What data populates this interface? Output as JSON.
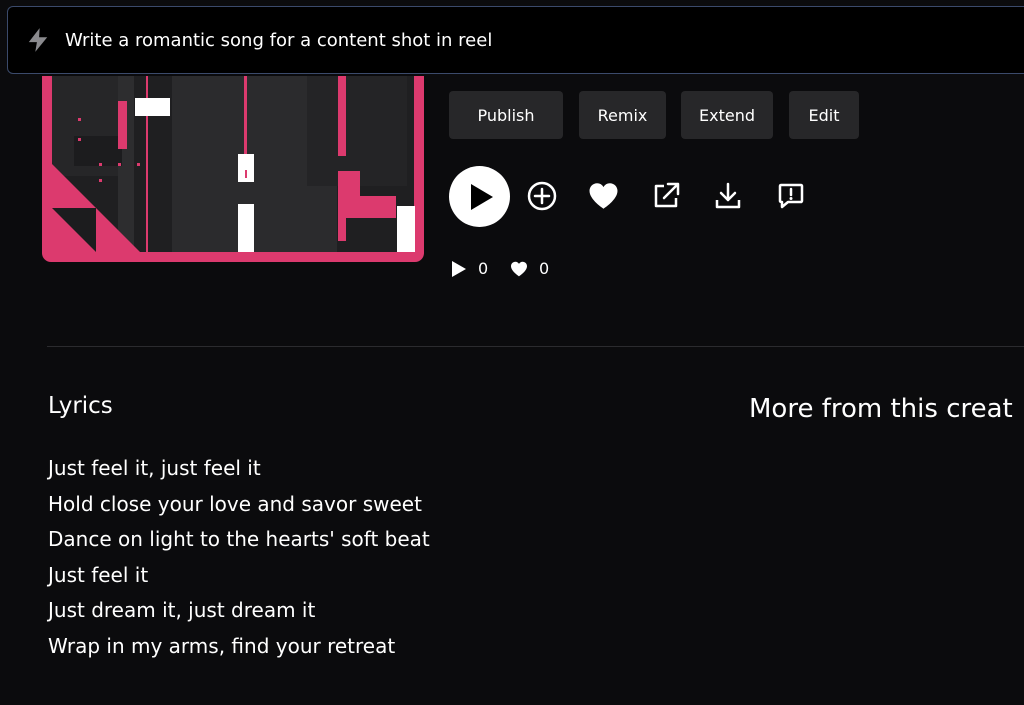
{
  "prompt": {
    "icon": "lightning-bolt-icon",
    "text": "Write a romantic song for a content shot in reel"
  },
  "cover": {
    "accent_color": "#dc3a6e",
    "background_color": "#1f1f21"
  },
  "actions": {
    "publish_label": "Publish",
    "remix_label": "Remix",
    "extend_label": "Extend",
    "edit_label": "Edit"
  },
  "controls": {
    "play_icon": "play-icon",
    "add_icon": "add-circle-icon",
    "like_icon": "heart-icon",
    "share_icon": "external-link-icon",
    "download_icon": "download-icon",
    "report_icon": "report-message-icon"
  },
  "stats": {
    "plays": "0",
    "likes": "0"
  },
  "lyrics": {
    "title": "Lyrics",
    "lines": [
      "Just feel it, just feel it",
      "Hold close your love and savor sweet",
      "Dance on light to the hearts' soft beat",
      "Just feel it",
      "Just dream it, just dream it",
      "Wrap in my arms, find your retreat"
    ]
  },
  "more_from_creator": {
    "title": "More from this creat"
  }
}
